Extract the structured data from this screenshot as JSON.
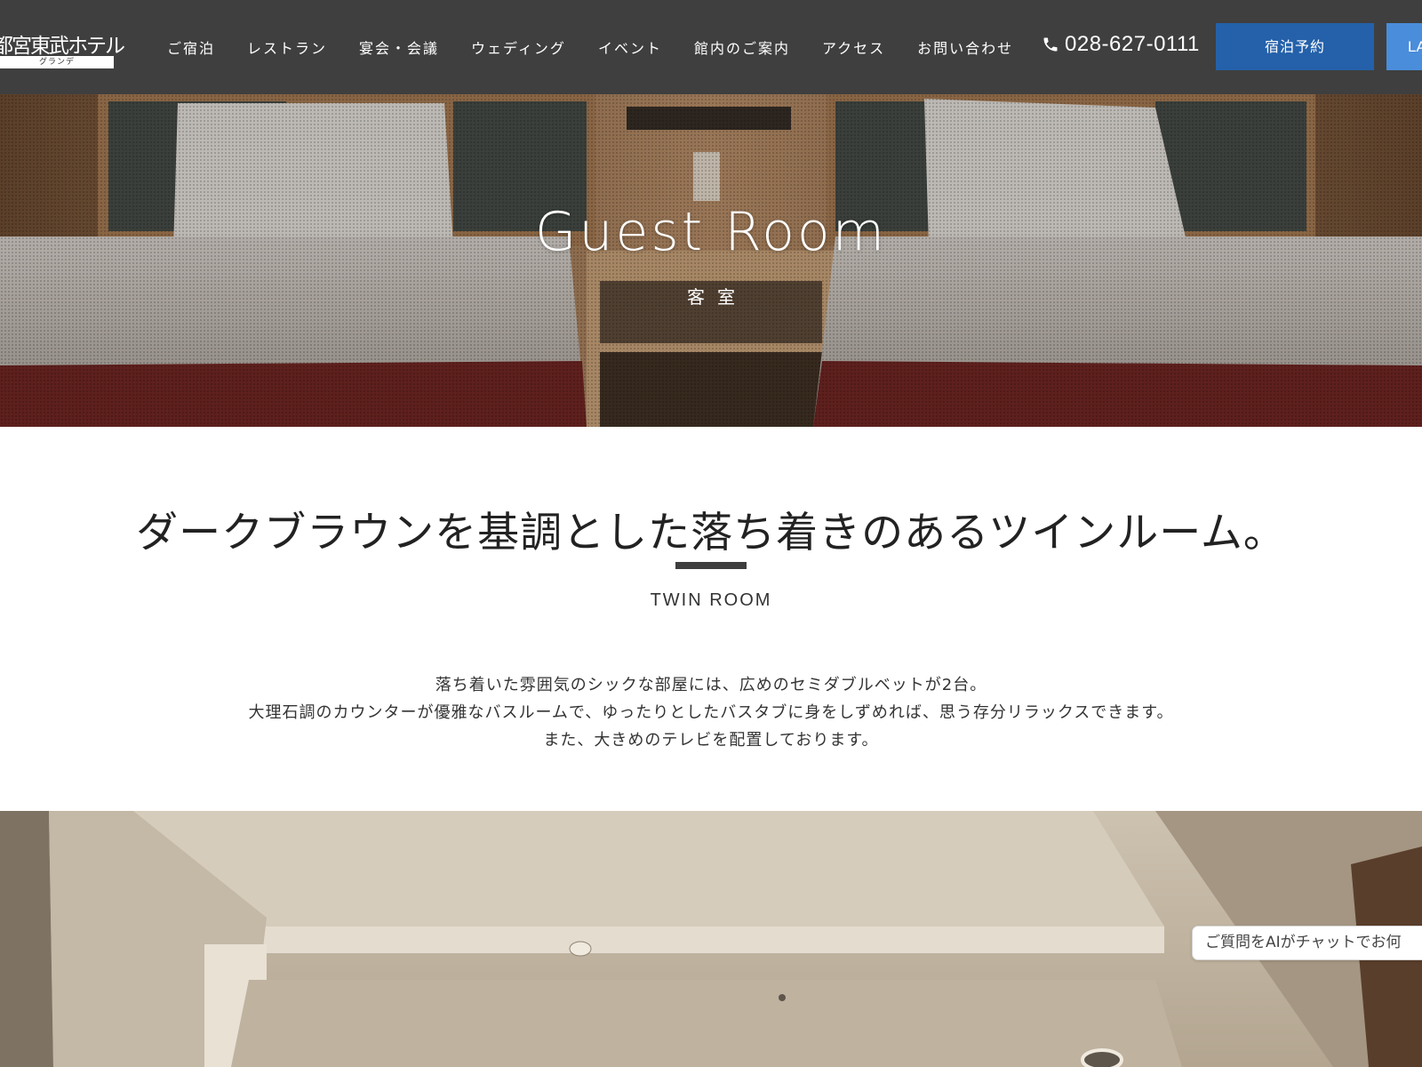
{
  "header": {
    "logo_text": "都宮東武ホテル",
    "logo_sub": "グランデ",
    "nav": [
      {
        "label": "ご宿泊"
      },
      {
        "label": "レストラン"
      },
      {
        "label": "宴会・会議"
      },
      {
        "label": "ウェディング"
      },
      {
        "label": "イベント"
      },
      {
        "label": "館内のご案内"
      },
      {
        "label": "アクセス"
      },
      {
        "label": "お問い合わせ"
      }
    ],
    "phone": "028-627-0111",
    "phone_icon": "phone-icon",
    "reserve_label": "宿泊予約",
    "lang_label": "LA",
    "bg_color": "#3f3f3f",
    "reserve_color": "#2461aa",
    "lang_color": "#4a8ddb"
  },
  "hero": {
    "title": "Guest Room",
    "subtitle": "客室"
  },
  "room": {
    "headline": "ダークブラウンを基調とした落ち着きのあるツインルーム。",
    "type": "TWIN ROOM",
    "description": [
      "落ち着いた雰囲気のシックな部屋には、広めのセミダブルベットが2台。",
      "大理石調のカウンターが優雅なバスルームで、ゆったりとしたバスタブに身をしずめれば、思う存分リラックスできます。",
      "また、大きめのテレビを配置しております。"
    ]
  },
  "chat": {
    "label": "ご質問をAIがチャットでお何"
  }
}
